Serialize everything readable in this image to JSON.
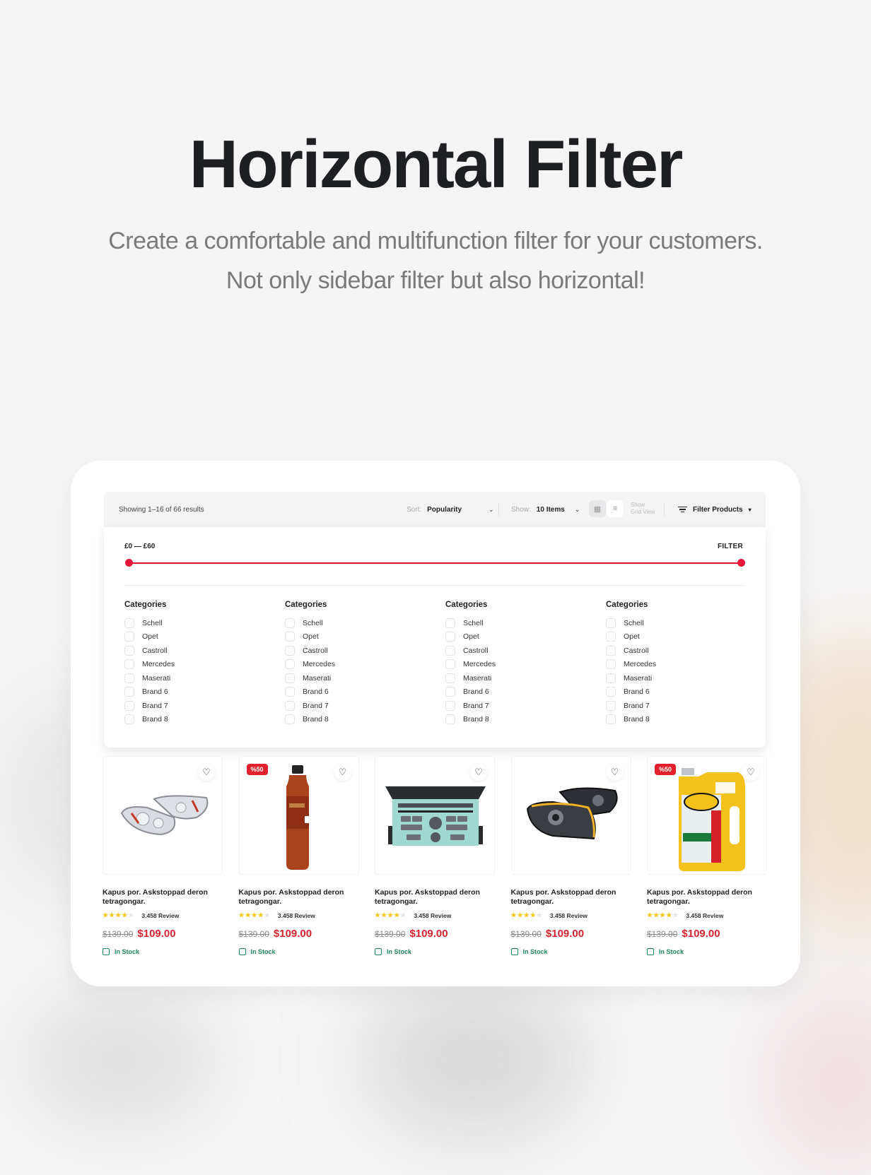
{
  "hero": {
    "title": "Horizontal Filter",
    "subtitle_line1": "Create a comfortable and multifunction filter for your customers.",
    "subtitle_line2": "Not only sidebar filter but also horizontal!"
  },
  "toolbar": {
    "results_text": "Showing 1–16 of 66 results",
    "sort_label": "Sort:",
    "sort_value": "Popularity",
    "show_label": "Show:",
    "show_value": "10 Items",
    "view_caption_line1": "Show",
    "view_caption_line2": "Grid View",
    "active_view": "grid",
    "filter_products_label": "Filter Products"
  },
  "filter": {
    "price_range_label": "£0 — £60",
    "price_min": 0,
    "price_max": 60,
    "filter_button_label": "FILTER",
    "accent_color": "#e0102f",
    "columns": [
      {
        "heading": "Categories",
        "items": [
          "Schell",
          "Opet",
          "Castroll",
          "Mercedes",
          "Maserati",
          "Brand 6",
          "Brand 7",
          "Brand 8"
        ]
      },
      {
        "heading": "Categories",
        "items": [
          "Schell",
          "Opet",
          "Castroll",
          "Mercedes",
          "Maserati",
          "Brand 6",
          "Brand 7",
          "Brand 8"
        ]
      },
      {
        "heading": "Categories",
        "items": [
          "Schell",
          "Opet",
          "Castroll",
          "Mercedes",
          "Maserati",
          "Brand 6",
          "Brand 7",
          "Brand 8"
        ]
      },
      {
        "heading": "Categories",
        "items": [
          "Schell",
          "Opet",
          "Castroll",
          "Mercedes",
          "Maserati",
          "Brand 6",
          "Brand 7",
          "Brand 8"
        ]
      }
    ]
  },
  "products": [
    {
      "image": "chrome-headlights",
      "badge": "",
      "name": "Kapus por. Askstoppad deron tetragongar.",
      "rating": 4,
      "reviews": "3.458 Review",
      "old_price": "$139.00",
      "price": "$109.00",
      "stock": "In Stock"
    },
    {
      "image": "oil-bottle",
      "badge": "%50",
      "name": "Kapus por. Askstoppad deron tetragongar.",
      "rating": 4,
      "reviews": "3.458 Review",
      "old_price": "$139.00",
      "price": "$109.00",
      "stock": "In Stock"
    },
    {
      "image": "car-radio",
      "badge": "",
      "name": "Kapus por. Askstoppad deron tetragongar.",
      "rating": 4,
      "reviews": "3.458 Review",
      "old_price": "$139.00",
      "price": "$109.00",
      "stock": "In Stock"
    },
    {
      "image": "dark-headlights",
      "badge": "",
      "name": "Kapus por. Askstoppad deron tetragongar.",
      "rating": 4,
      "reviews": "3.458 Review",
      "old_price": "$139.00",
      "price": "$109.00",
      "stock": "In Stock"
    },
    {
      "image": "motor-oil-jug",
      "badge": "%50",
      "name": "Kapus por. Askstoppad deron tetragongar.",
      "rating": 4,
      "reviews": "3.458 Review",
      "old_price": "$139.00",
      "price": "$109.00",
      "stock": "In Stock"
    }
  ],
  "colors": {
    "sale_price": "#d8232f",
    "badge": "#e5202d",
    "stock": "#1f8a5c",
    "star": "#f5c518"
  }
}
